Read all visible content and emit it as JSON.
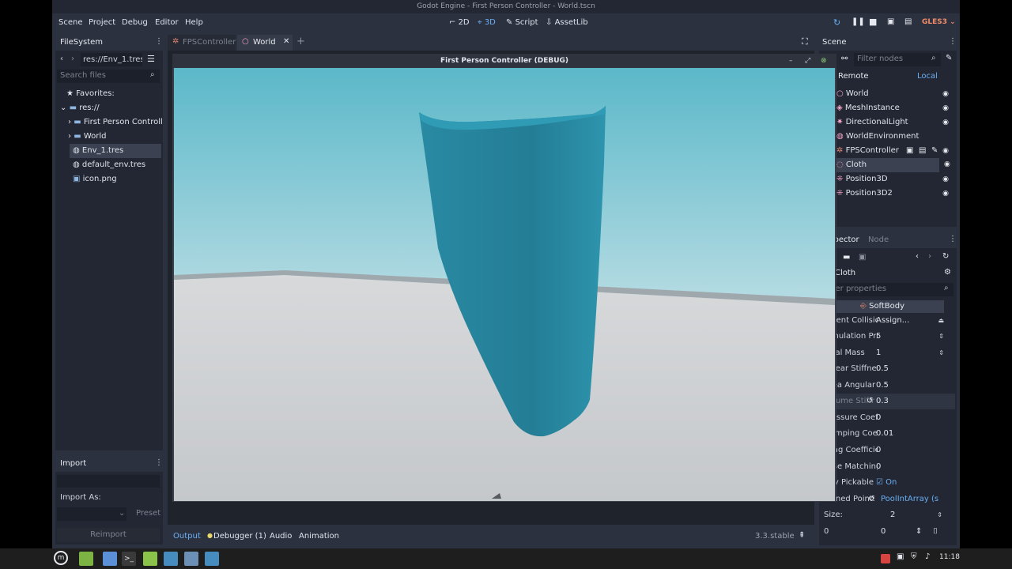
{
  "window": {
    "title": "Godot Engine - First Person Controller - World.tscn"
  },
  "menu": [
    "Scene",
    "Project",
    "Debug",
    "Editor",
    "Help"
  ],
  "modes": {
    "m2d": "2D",
    "m3d": "3D",
    "script": "Script",
    "assetlib": "AssetLib"
  },
  "renderer": "GLES3",
  "filesystem": {
    "tab": "FileSystem",
    "path": "res://Env_1.tres",
    "search_placeholder": "Search files",
    "favorites": "Favorites:",
    "root": "res://",
    "items": [
      "First Person Controll",
      "World",
      "Env_1.tres",
      "default_env.tres",
      "icon.png"
    ]
  },
  "import": {
    "tab": "Import",
    "import_as": "Import As:",
    "preset": "Preset",
    "reimport": "Reimport"
  },
  "scene_tabs": [
    "FPSController",
    "World"
  ],
  "scene_dock": {
    "tab": "Scene",
    "filter_placeholder": "Filter nodes",
    "remote": "Remote",
    "local": "Local",
    "nodes": [
      "World",
      "MeshInstance",
      "DirectionalLight",
      "WorldEnvironment",
      "FPSController",
      "Cloth",
      "Position3D",
      "Position3D2"
    ]
  },
  "inspector": {
    "tab_inspector": "Inspector",
    "tab_node": "Node",
    "object": "Cloth",
    "filter_placeholder": "Filter properties",
    "section": "SoftBody",
    "rows": [
      {
        "label": "Parent Collision",
        "value": "Assign..."
      },
      {
        "label": "Simulation Precision",
        "value": "5"
      },
      {
        "label": "Total Mass",
        "value": "1"
      },
      {
        "label": "Linear Stiffness",
        "value": "0.5"
      },
      {
        "label": "Area Angular Stiffness",
        "value": "0.5"
      },
      {
        "label": "Volume Stiffness",
        "value": "0.3"
      },
      {
        "label": "Pressure Coefficient",
        "value": "0"
      },
      {
        "label": "Damping Coefficient",
        "value": "0.01"
      },
      {
        "label": "Drag Coefficient",
        "value": "0"
      },
      {
        "label": "Pose Matching",
        "value": "0"
      },
      {
        "label": "Ray Pickable",
        "value": "On"
      },
      {
        "label": "Pinned Points",
        "value": "PoolIntArray (s"
      }
    ],
    "size_label": "Size:",
    "size_value": "2",
    "index_label": "0",
    "index_value": "0"
  },
  "game_window": {
    "title": "First Person Controller (DEBUG)"
  },
  "bottom": {
    "tabs": [
      "Output",
      "Debugger (1)",
      "Audio",
      "Animation"
    ],
    "version": "3.3.stable"
  },
  "taskbar": {
    "time": "11:18"
  },
  "colors": {
    "accent": "#6ab0f3",
    "cloth": "#2a8aa3",
    "sky": "#5bb8c9"
  }
}
